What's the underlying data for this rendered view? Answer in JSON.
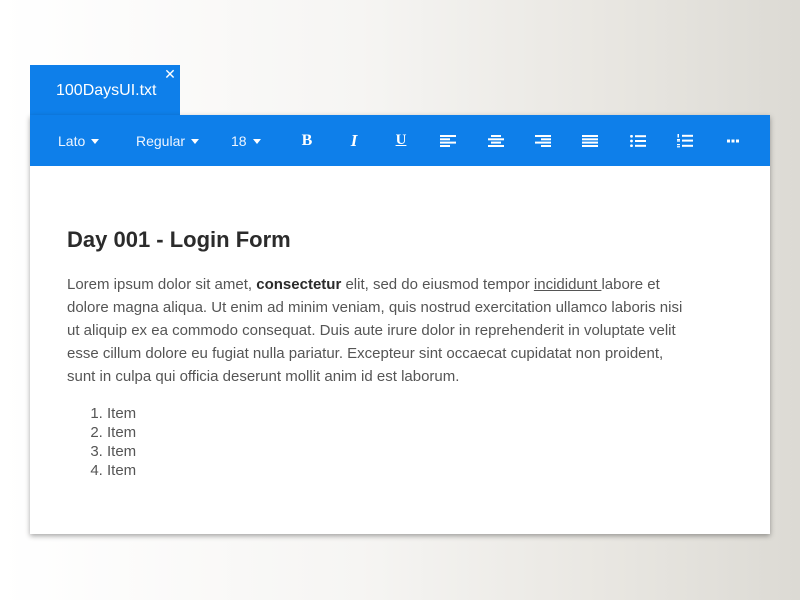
{
  "tab": {
    "label": "100DaysUI.txt",
    "close_glyph": "✕"
  },
  "toolbar": {
    "font_family": "Lato",
    "font_weight": "Regular",
    "font_size": "18",
    "bold_label": "B",
    "italic_label": "I",
    "underline_label": "U",
    "icons": [
      "align-left-icon",
      "align-center-icon",
      "align-right-icon",
      "align-justify-icon",
      "bullet-list-icon",
      "numbered-list-icon",
      "more-icon"
    ]
  },
  "document": {
    "title": "Day 001 - Login Form",
    "paragraph": {
      "part1": "Lorem ipsum dolor sit amet, ",
      "bold": "consectetur",
      "part2": " elit, sed do eiusmod tempor ",
      "underlined": "incididunt ",
      "part3": "labore et dolore magna aliqua. Ut enim ad minim veniam, quis nostrud exercitation ullamco laboris nisi ut aliquip ex ea commodo consequat. Duis aute irure dolor in reprehenderit in voluptate velit esse cillum dolore eu fugiat nulla pariatur. Excepteur sint occaecat cupidatat non proident, sunt in culpa qui officia deserunt mollit anim id est laborum."
    },
    "list_items": [
      "Item",
      "Item",
      "Item",
      "Item"
    ]
  },
  "colors": {
    "accent": "#0e7fea",
    "title_text": "#2b2b2b",
    "body_text": "#555555"
  }
}
